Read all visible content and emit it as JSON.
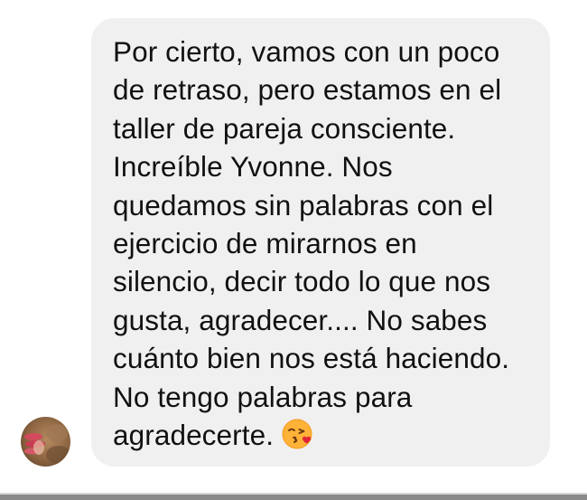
{
  "message": {
    "sender_avatar": "avatar-photo",
    "lines": [
      "Por cierto, vamos con un poco",
      "de retraso, pero estamos en el",
      "taller de pareja consciente.",
      "Increíble Yvonne. Nos",
      "quedamos sin palabras con el",
      "ejercicio de mirarnos en",
      "silencio, decir todo lo que nos",
      "gusta, agradecer.... No sabes",
      "cuánto bien nos está haciendo.",
      "No tengo palabras para",
      "agradecerte."
    ],
    "emoji": "kissing-face-with-heart-emoji"
  },
  "colors": {
    "bubble": "#f1f0f0",
    "text": "#111111",
    "background": "#ffffff"
  }
}
